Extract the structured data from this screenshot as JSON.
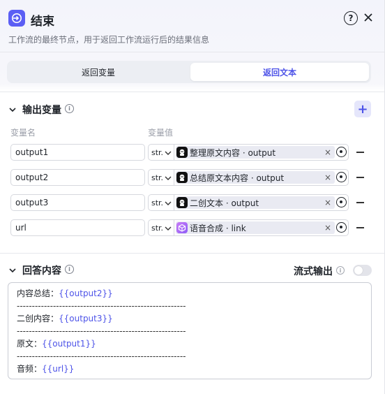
{
  "header": {
    "title": "结束",
    "description": "工作流的最终节点，用于返回工作流运行后的结果信息"
  },
  "tabs": {
    "left_label": "返回变量",
    "right_label": "返回文本",
    "selected": "返回文本"
  },
  "output_section": {
    "title": "输出变量",
    "add_label": "+",
    "col_name": "变量名",
    "col_value": "变量值",
    "rows": [
      {
        "name": "output1",
        "type": "str.",
        "ref": "整理原文内容 · output",
        "icon": "robot-icon"
      },
      {
        "name": "output2",
        "type": "str.",
        "ref": "总结原文本内容 · output",
        "icon": "robot-icon"
      },
      {
        "name": "output3",
        "type": "str.",
        "ref": "二创文本 · output",
        "icon": "robot-icon"
      },
      {
        "name": "url",
        "type": "str.",
        "ref": "语音合成 · link",
        "icon": "tts-cube-icon"
      }
    ],
    "clear_glyph": "×"
  },
  "answer_section": {
    "title": "回答内容",
    "stream_label": "流式输出",
    "stream_on": false,
    "lines": [
      {
        "prefix": "内容总结：",
        "var": "{{output2}}"
      },
      {
        "prefix": "--------------------------------------------------------",
        "var": ""
      },
      {
        "prefix": "二创内容：",
        "var": "{{output3}}"
      },
      {
        "prefix": "--------------------------------------------------------",
        "var": ""
      },
      {
        "prefix": "原文：",
        "var": "{{output1}}"
      },
      {
        "prefix": "--------------------------------------------------------",
        "var": ""
      },
      {
        "prefix": "音频：",
        "var": "{{url}}"
      }
    ]
  },
  "colors": {
    "accent": "#4d53e8",
    "node_icon": "#5b5ef4"
  }
}
